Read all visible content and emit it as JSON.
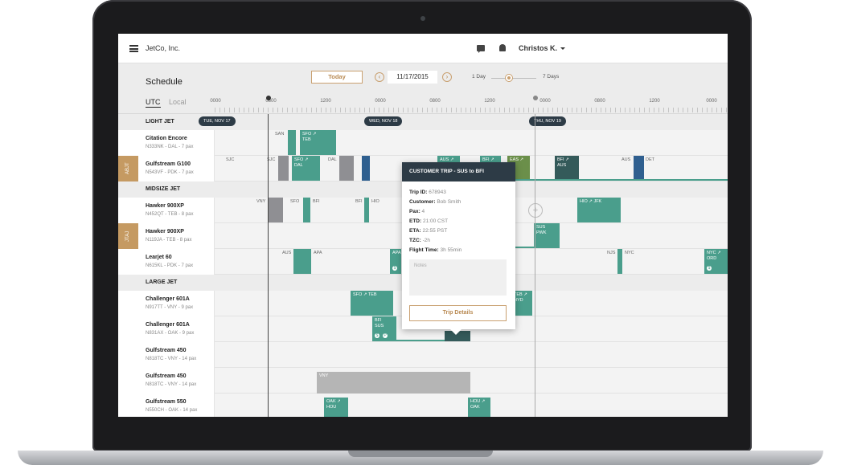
{
  "app": {
    "company": "JetCo, Inc.",
    "user": "Christos K."
  },
  "header": {
    "title": "Schedule",
    "today": "Today",
    "date": "11/17/2015",
    "range_min": "1 Day",
    "range_max": "7 Days"
  },
  "timezone": {
    "utc": "UTC",
    "local": "Local"
  },
  "timeline": {
    "ticks": [
      "0000",
      "0800",
      "1200",
      "0000",
      "0800",
      "1200",
      "0000",
      "0800",
      "1200",
      "0000"
    ],
    "days": [
      "TUE, NOV 17",
      "WED, NOV 18",
      "THU, NOV 19"
    ]
  },
  "sections": [
    "LIGHT JET",
    "MIDSIZE JET",
    "LARGE JET"
  ],
  "aircraft": [
    {
      "name": "Citation Encore",
      "sub": "N333NK - DAL - 7 pax",
      "tag": ""
    },
    {
      "name": "Gulfstream G100",
      "sub": "N543VF - PDK - 7 pax",
      "tag": "ABJT"
    },
    {
      "name": "Hawker 900XP",
      "sub": "N452QT - TEB - 8 pax",
      "tag": ""
    },
    {
      "name": "Hawker 900XP",
      "sub": "N119JA - TEB - 8 pax",
      "tag": "JTAJ"
    },
    {
      "name": "Learjet 60",
      "sub": "N615KL - PDK - 7 pax",
      "tag": ""
    },
    {
      "name": "Challenger 601A",
      "sub": "N917TT - VNY - 9 pax",
      "tag": ""
    },
    {
      "name": "Challenger 601A",
      "sub": "N831AX - OAK - 9 pax",
      "tag": ""
    },
    {
      "name": "Gulfstream 450",
      "sub": "N818TC - VNY - 14 pax",
      "tag": ""
    },
    {
      "name": "Gulfstream 450",
      "sub": "N818TC - VNY - 14 pax",
      "tag": ""
    },
    {
      "name": "Gulfstream 550",
      "sub": "N550CH - OAK - 14 pax",
      "tag": ""
    }
  ],
  "trips": {
    "r0": [
      "SAN",
      "SFO ↗",
      "TEB"
    ],
    "r1": [
      "SJC",
      "SJC",
      "SFO ↗",
      "DAL",
      "DAL",
      "AUS ↗",
      "BFI ↗",
      "EAS ↗",
      "BFI ↗",
      "AUS",
      "AUS",
      "DET"
    ],
    "r2": [
      "VNY",
      "SFO",
      "BFI",
      "BFI",
      "HIO",
      "HIO ↗ JFK"
    ],
    "r3": [
      "SUS",
      "PWK"
    ],
    "r4": [
      "AUS",
      "APA",
      "APA",
      "NJS",
      "NYC",
      "NYC ↗",
      "ORD"
    ],
    "r5": [
      "SFO ↗ TEB",
      "TEB ↗",
      "HYD"
    ],
    "r6": [
      "BFI",
      "SUS"
    ],
    "r8": [
      "VNY"
    ],
    "r9": [
      "OAK ↗",
      "HOU",
      "HOU ↗",
      "OAK"
    ]
  },
  "popover": {
    "title": "CUSTOMER TRIP - SUS to BFI",
    "trip_id_label": "Trip ID:",
    "trip_id": "678943",
    "customer_label": "Customer:",
    "customer": "Bob Smith",
    "pax_label": "Pax:",
    "pax": "4",
    "etd_label": "ETD:",
    "etd": "21:00 CST",
    "eta_label": "ETA:",
    "eta": "22:55 PST",
    "tzc_label": "TZC:",
    "tzc": "-2h",
    "flight_time_label": "Flight Time:",
    "flight_time": "3h 55min",
    "notes_placeholder": "Notes",
    "details_button": "Trip Details"
  },
  "colors": {
    "accent": "#c59a62",
    "trip": "#4a9e8c",
    "dark": "#2d3b46"
  }
}
